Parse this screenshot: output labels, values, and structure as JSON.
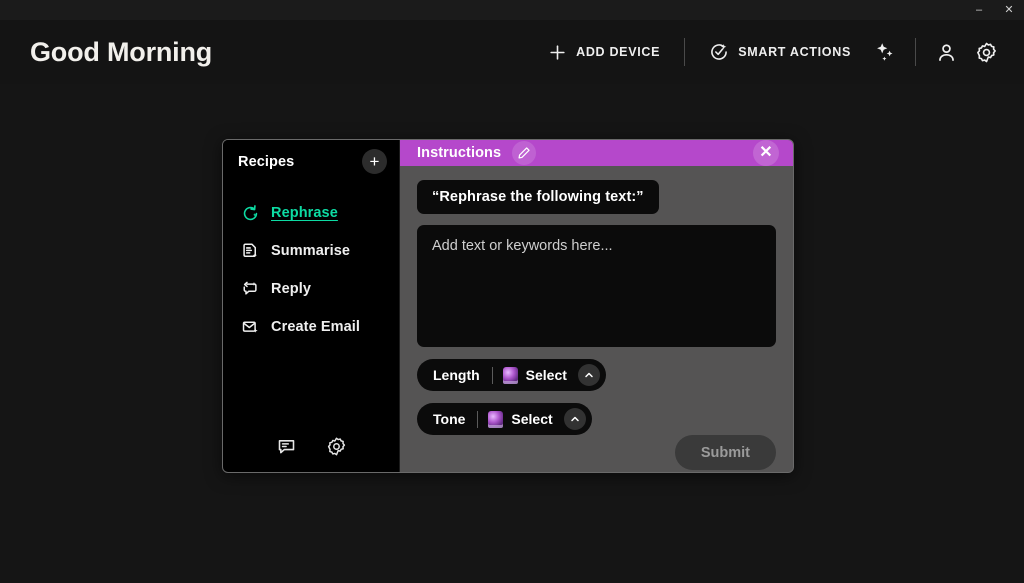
{
  "window": {
    "minimize_label": "–",
    "close_label": "✕"
  },
  "header": {
    "greeting": "Good Morning",
    "add_device_label": "ADD DEVICE",
    "smart_actions_label": "SMART ACTIONS"
  },
  "modal": {
    "sidebar": {
      "title": "Recipes",
      "add_label": "+",
      "items": [
        {
          "label": "Rephrase",
          "icon": "refresh-sparkle-icon",
          "active": true
        },
        {
          "label": "Summarise",
          "icon": "document-sparkle-icon",
          "active": false
        },
        {
          "label": "Reply",
          "icon": "reply-sparkle-icon",
          "active": false
        },
        {
          "label": "Create Email",
          "icon": "envelope-sparkle-icon",
          "active": false
        }
      ],
      "footer_icons": [
        "chat-bubble-icon",
        "gear-icon"
      ]
    },
    "pane": {
      "title": "Instructions",
      "edit_icon": "pencil-icon",
      "close_label": "✕",
      "prompt": "“Rephrase the following text:”",
      "textarea_placeholder": "Add text or keywords here...",
      "selectors": [
        {
          "label": "Length",
          "value": "Select"
        },
        {
          "label": "Tone",
          "value": "Select"
        }
      ],
      "submit_label": "Submit"
    }
  },
  "colors": {
    "accent_purple": "#b548cb",
    "accent_teal": "#0ddba3",
    "panel_gray": "#555454",
    "app_background": "#151515"
  }
}
